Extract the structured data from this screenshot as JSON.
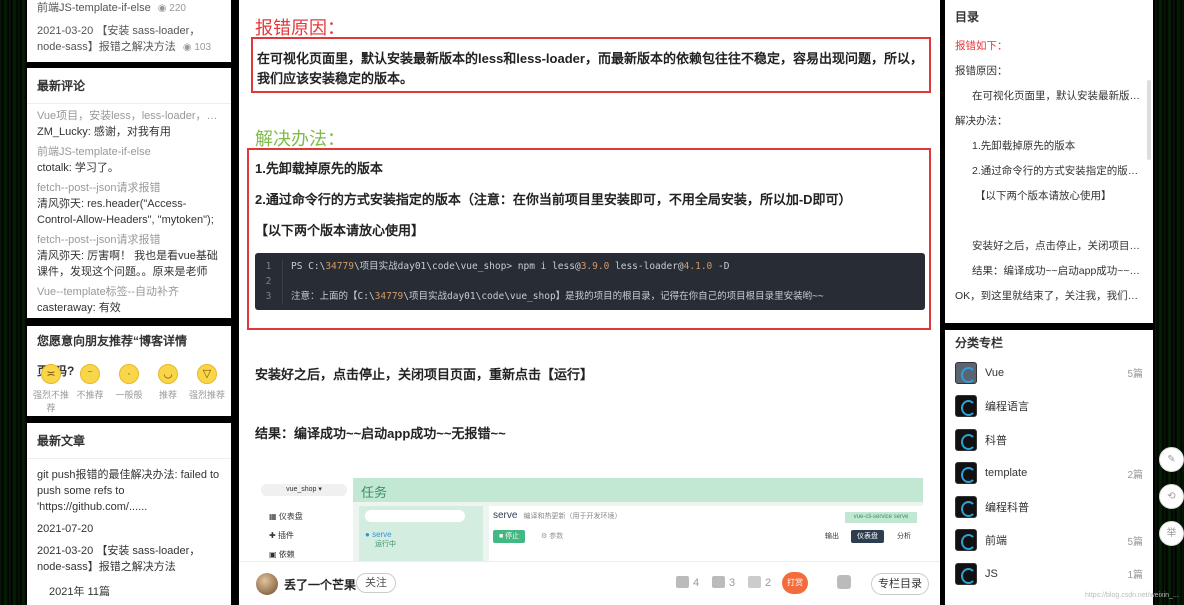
{
  "top_articles": [
    {
      "title": "前端JS-template-if-else",
      "views": "220"
    },
    {
      "title": "2021-03-20 【安装 sass-loader，node-sass】报错之解决方法",
      "views": "103"
    }
  ],
  "latest_comments": {
    "title": "最新评论",
    "items": [
      {
        "article": "Vue项目，安装less，less-loader，报错...",
        "comment": "ZM_Lucky: 感谢，对我有用"
      },
      {
        "article": "前端JS-template-if-else",
        "comment": "ctotalk: 学习了。"
      },
      {
        "article": "fetch--post--json请求报错",
        "comment": "清风弥天: res.header(\"Access-Control-Allow-Headers\", \"mytoken\");这个代码替换下"
      },
      {
        "article": "fetch--post--json请求报错",
        "comment": "清风弥天: 厉害啊！ 我也是看vue基础课件，发现这个问题。。原来是老师expre..."
      },
      {
        "article": "Vue--template标签--自动补齐",
        "comment": "casteraway: 有效"
      }
    ]
  },
  "recommend": {
    "title": "您愿意向朋友推荐“博客详情页”吗?",
    "options": [
      {
        "label": "强烈不推荐",
        "face": "≍"
      },
      {
        "label": "不推荐",
        "face": "⁻"
      },
      {
        "label": "一般般",
        "face": "·"
      },
      {
        "label": "推荐",
        "face": "◡"
      },
      {
        "label": "强烈推荐",
        "face": "▽"
      }
    ]
  },
  "latest_articles": {
    "title": "最新文章",
    "items": [
      {
        "title": "git push报错的最佳解决办法: failed to push some refs to 'https://github.com/......",
        "date": "2021-07-20"
      },
      {
        "title": "2021-03-20 【安装 sass-loader，node-sass】报错之解决方法",
        "date": ""
      }
    ],
    "archive": "2021年  11篇"
  },
  "article": {
    "h_cause": "报错原因：",
    "cause_text": "在可视化页面里，默认安装最新版本的less和less-loader，而最新版本的依赖包往往不稳定，容易出现问题，所以，我们应该安装稳定的版本。",
    "h_solution": "解决办法：",
    "step1": "1.先卸载掉原先的版本",
    "step2": "2.通过命令行的方式安装指定的版本（注意：在你当前项目里安装即可，不用全局安装，所以加-D即可）",
    "note": "【以下两个版本请放心使用】",
    "code": [
      {
        "ln": "1",
        "pre": "PS C:\\",
        "num": "34779",
        "post": "\\项目实战day01\\code\\vue_shop> npm i less@",
        "v1": "3.9.0",
        "mid": " less-loader@",
        "v2": "4.1.0",
        "end": " -D"
      },
      {
        "ln": "2",
        "pre": "",
        "num": "",
        "post": "",
        "v1": "",
        "mid": "",
        "v2": "",
        "end": ""
      },
      {
        "ln": "3",
        "pre": "注意：上面的【C:\\",
        "num": "34779",
        "post": "\\项目实战day01\\code\\vue_shop】是我的项目的根目录，记得在你自己的项目根目录里安装哟~~",
        "v1": "",
        "mid": "",
        "v2": "",
        "end": ""
      }
    ],
    "after1": "安装好之后，点击停止，关闭项目页面，重新点击【运行】",
    "after2": "结果：编译成功~~启动app成功~~无报错~~"
  },
  "embed": {
    "project": "vue_shop ▾",
    "header": "任务",
    "nav": [
      "仪表盘",
      "插件",
      "依赖"
    ],
    "task_name": "serve",
    "task_status": "运行中",
    "serve_title": "serve",
    "serve_desc": "编译和热更新（用于开发环境）",
    "stop": "■ 停止",
    "params": "⚙ 参数",
    "command": "vue-cli-service serve",
    "output": "输出",
    "dashboard": "仪表盘",
    "analyze": "分析"
  },
  "toolbar": {
    "author": "丢了一个芒果",
    "follow": "关注",
    "likes": "4",
    "comments": "3",
    "favorites": "2",
    "reward": "打赏",
    "toc": "专栏目录"
  },
  "toc": {
    "title": "目录",
    "items": [
      {
        "label": "报错如下：",
        "level": 1,
        "active": true
      },
      {
        "label": "报错原因：",
        "level": 1,
        "active": false
      },
      {
        "label": "在可视化页面里，默认安装最新版本...",
        "level": 2,
        "active": false
      },
      {
        "label": "解决办法：",
        "level": 1,
        "active": false
      },
      {
        "label": "1.先卸载掉原先的版本",
        "level": 2,
        "active": false
      },
      {
        "label": "2.通过命令行的方式安装指定的版本...",
        "level": 2,
        "active": false
      },
      {
        "label": "【以下两个版本请放心使用】",
        "level": 2,
        "active": false
      },
      {
        "label": "",
        "level": 2,
        "active": false
      },
      {
        "label": "安装好之后，点击停止，关闭项目页...",
        "level": 2,
        "active": false
      },
      {
        "label": "结果：编译成功~~启动app成功~~无...",
        "level": 2,
        "active": false
      },
      {
        "label": "OK，到这里就结束了，关注我，我们一...",
        "level": 1,
        "active": false
      }
    ]
  },
  "columns": {
    "title": "分类专栏",
    "items": [
      {
        "name": "Vue",
        "count": "5篇"
      },
      {
        "name": "编程语言",
        "count": ""
      },
      {
        "name": "科普",
        "count": ""
      },
      {
        "name": "template",
        "count": "2篇"
      },
      {
        "name": "编程科普",
        "count": ""
      },
      {
        "name": "前端",
        "count": "5篇"
      },
      {
        "name": "JS",
        "count": "1篇"
      }
    ]
  },
  "watermark": "https://blog.csdn.net/weixin_..."
}
